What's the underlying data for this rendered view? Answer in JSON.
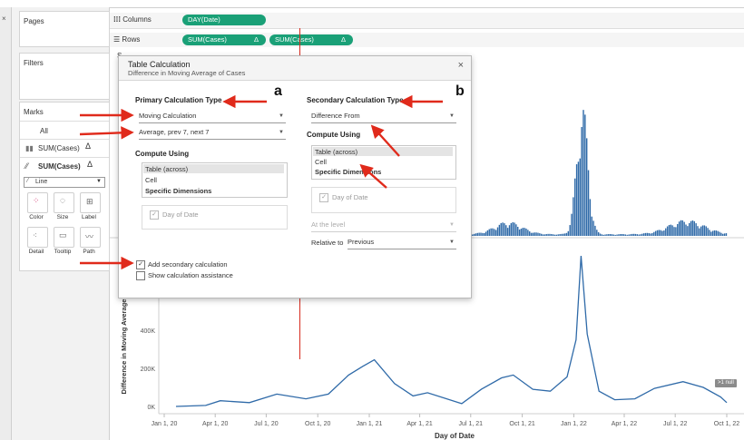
{
  "shelves": {
    "pages_label": "Pages",
    "columns_label": "Columns",
    "rows_label": "Rows",
    "columns_pill": "DAY(Date)",
    "rows_pills": [
      "SUM(Cases)",
      "SUM(Cases)"
    ],
    "delta": "Δ"
  },
  "left_panel": {
    "filters_label": "Filters",
    "marks_label": "Marks",
    "all_label": "All",
    "mark1": "SUM(Cases)",
    "mark2": "SUM(Cases)",
    "mark_type": "Line",
    "controls": [
      "Color",
      "Size",
      "Label",
      "Detail",
      "Tooltip",
      "Path"
    ]
  },
  "dialog": {
    "title": "Table Calculation",
    "subtitle": "Difference in Moving Average of Cases",
    "close": "×",
    "primary": {
      "heading": "Primary Calculation Type",
      "type_value": "Moving Calculation",
      "sub_value": "Average, prev 7, next 7",
      "compute_heading": "Compute Using",
      "items": [
        "Table (across)",
        "Cell",
        "Specific Dimensions"
      ],
      "dim_item": "Day of Date"
    },
    "secondary": {
      "heading": "Secondary Calculation Type",
      "type_value": "Difference From",
      "compute_heading": "Compute Using",
      "items": [
        "Table (across)",
        "Cell",
        "Specific Dimensions"
      ],
      "dim_item": "Day of Date",
      "level_label": "At the level",
      "relative_label": "Relative to",
      "relative_value": "Previous"
    },
    "add_secondary": "Add secondary calculation",
    "show_assist": "Show calculation assistance"
  },
  "annotations": {
    "a": "a",
    "b": "b"
  },
  "chart_data": {
    "type": "line",
    "xlabel": "Day of Date",
    "ylabel": "Difference in Moving Average",
    "x_ticks": [
      "Jan 1, 20",
      "Apr 1, 20",
      "Jul 1, 20",
      "Oct 1, 20",
      "Jan 1, 21",
      "Apr 1, 21",
      "Jul 1, 21",
      "Oct 1, 21",
      "Jan 1, 22",
      "Apr 1, 22",
      "Jul 1, 22",
      "Oct 1, 22"
    ],
    "y_ticks": [
      "0K",
      "200K",
      "400K"
    ],
    "ylim": [
      0,
      800000
    ],
    "null_badge": ">1 null",
    "series": [
      {
        "x": [
          "2020-01-22",
          "2020-03-15",
          "2020-04-10",
          "2020-06-01",
          "2020-07-20",
          "2020-09-10",
          "2020-10-20",
          "2020-11-25",
          "2020-12-20",
          "2021-01-10",
          "2021-02-15",
          "2021-03-20",
          "2021-04-15",
          "2021-06-15",
          "2021-07-20",
          "2021-08-25",
          "2021-09-15",
          "2021-10-20",
          "2021-11-20",
          "2021-12-20",
          "2022-01-05",
          "2022-01-14",
          "2022-01-25",
          "2022-02-15",
          "2022-03-15",
          "2022-04-20",
          "2022-05-25",
          "2022-07-15",
          "2022-08-20",
          "2022-09-20",
          "2022-10-01"
        ],
        "y": [
          0,
          5000,
          30000,
          20000,
          65000,
          40000,
          65000,
          165000,
          210000,
          245000,
          120000,
          55000,
          72000,
          15000,
          90000,
          150000,
          165000,
          90000,
          80000,
          155000,
          350000,
          790000,
          380000,
          80000,
          35000,
          40000,
          95000,
          130000,
          100000,
          50000,
          20000
        ]
      }
    ],
    "upper_panel": {
      "type": "bar",
      "description_free": true,
      "x_range": [
        "2020-01-22",
        "2022-10-01"
      ],
      "peak_month": "Jan 2022"
    }
  }
}
